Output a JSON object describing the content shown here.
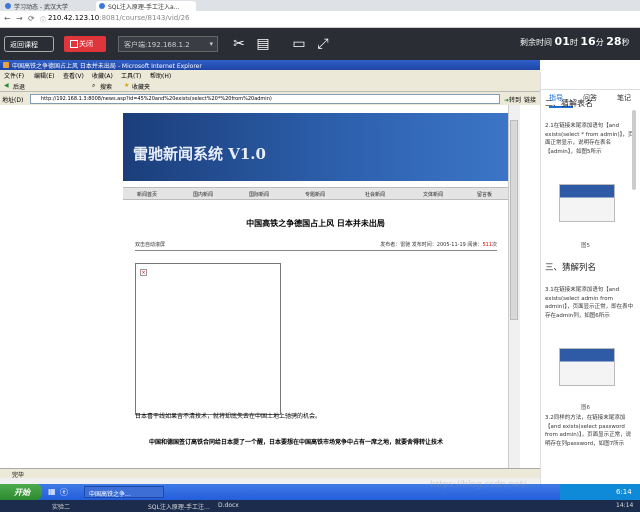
{
  "browser": {
    "tabs": [
      "学习动态 - 武汉大学",
      "SQL注入原理-手工注入a..."
    ],
    "url_host": "210.42.123.10",
    "url_path": ":8081/course/8143/vid/26"
  },
  "toolbar": {
    "back_label": "返回课程",
    "close_label": "关闭",
    "client_label": "客户端:192.168.1.2",
    "timer_prefix": "剩余时间",
    "hours": "01",
    "hour_unit": "时",
    "minutes": "16",
    "minute_unit": "分",
    "seconds": "28",
    "second_unit": "秒"
  },
  "ie": {
    "title": "中国高铁之争德国占上风 日本并未出局 - Microsoft Internet Explorer",
    "menu": [
      "文件(F)",
      "编辑(E)",
      "查看(V)",
      "收藏(A)",
      "工具(T)",
      "帮助(H)"
    ],
    "std": [
      "后退",
      "搜索",
      "收藏夹"
    ],
    "address_label": "地址(D)",
    "address_value": "http://192.168.1.3:8008/news.asp?id=45%20and%20exists(select%20*%20from%20admin)",
    "go_label": "转到",
    "links_label": "链接",
    "status": "完毕"
  },
  "site": {
    "brand": "雷驰新闻系统 V1.0",
    "nav": [
      "新闻首页",
      "国内新闻",
      "国际新闻",
      "专题新闻",
      "社会新闻",
      "文体新闻",
      "留言板"
    ],
    "article_title": "中国高铁之争德国占上风  日本并未出局",
    "source": "双击自动滚屏",
    "meta_prefix": "发布者：雷驰  发布时间：2005-11-19 阅读：",
    "reads": "511",
    "reads_unit": "次",
    "p1": "日本喜干线如果吉不清技术，就将却底失去在中国土地上驰骋的机会。",
    "p2": "中国和德国签订高铁合同给日本提了一个醒，日本要想在中国高铁市场竞争中占有一席之地，就要舍得转让技术"
  },
  "taskbar": {
    "start": "开始",
    "task_ie": "中国高铁之争...",
    "clock": "6:14"
  },
  "wintaskbar": {
    "items": [
      "实验二",
      "SQL注入原理-手工注...",
      "D.docx",
      "14:14"
    ]
  },
  "side": {
    "tabs": [
      "指导",
      "问答",
      "笔记"
    ],
    "h_prev": "二、猜解表名",
    "p1": "2.1在链接末尾添加语句【and exists(select * from admin)】，页面正常显示，说明存在表名【admin】，如图5所示",
    "cap5": "图5",
    "h3": "三、猜解列名",
    "p2": "3.1在链接末尾添加语句【and exists(select admin from admin)】，页面显示正常，即在表中存在admin列，如图6所示",
    "cap6": "图6",
    "p3": "3.2同样的方法，在链接末尾添加【and exists(select password from admin)】，页面显示正常，说明存在列password，如图7所示"
  },
  "watermark": "https://blog.csdn.net/..."
}
